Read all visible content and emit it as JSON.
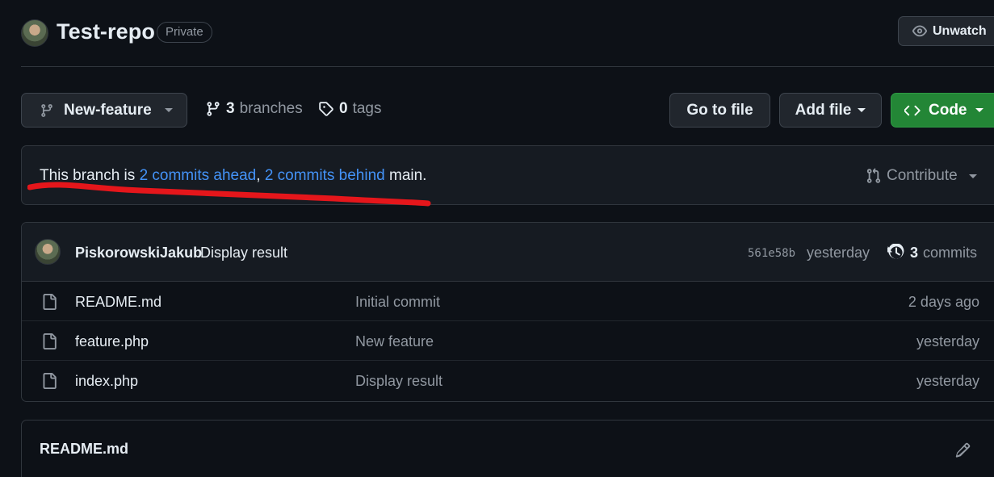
{
  "repo": {
    "name": "Test-repo",
    "visibility": "Private",
    "watch_label": "Unwatch"
  },
  "toolbar": {
    "branch": "New-feature",
    "branches_count": "3",
    "branches_label": "branches",
    "tags_count": "0",
    "tags_label": "tags",
    "goto_file_label": "Go to file",
    "add_file_label": "Add file",
    "code_label": "Code"
  },
  "branch_status": {
    "prefix": "This branch is",
    "ahead_link": "2 commits ahead",
    "separator": ",",
    "behind_link": "2 commits behind",
    "suffix": "main.",
    "contribute_label": "Contribute"
  },
  "latest_commit": {
    "author": "PiskorowskiJakub",
    "message": "Display result",
    "sha": "561e58b",
    "time": "yesterday",
    "commit_count": "3",
    "commit_count_label": "commits"
  },
  "files": [
    {
      "name": "README.md",
      "commit": "Initial commit",
      "time": "2 days ago"
    },
    {
      "name": "feature.php",
      "commit": "New feature",
      "time": "yesterday"
    },
    {
      "name": "index.php",
      "commit": "Display result",
      "time": "yesterday"
    }
  ],
  "readme": {
    "title": "README.md"
  },
  "colors": {
    "background": "#0d1117",
    "link": "#4493f8",
    "code_button": "#238636",
    "annotation": "#e5161b"
  },
  "icons": {
    "watch": "eye-icon",
    "branch": "git-branch-icon",
    "tag": "tag-icon",
    "code": "code-icon",
    "contribute": "git-pull-request-icon",
    "history": "history-icon",
    "file": "file-icon",
    "edit": "pencil-icon"
  }
}
